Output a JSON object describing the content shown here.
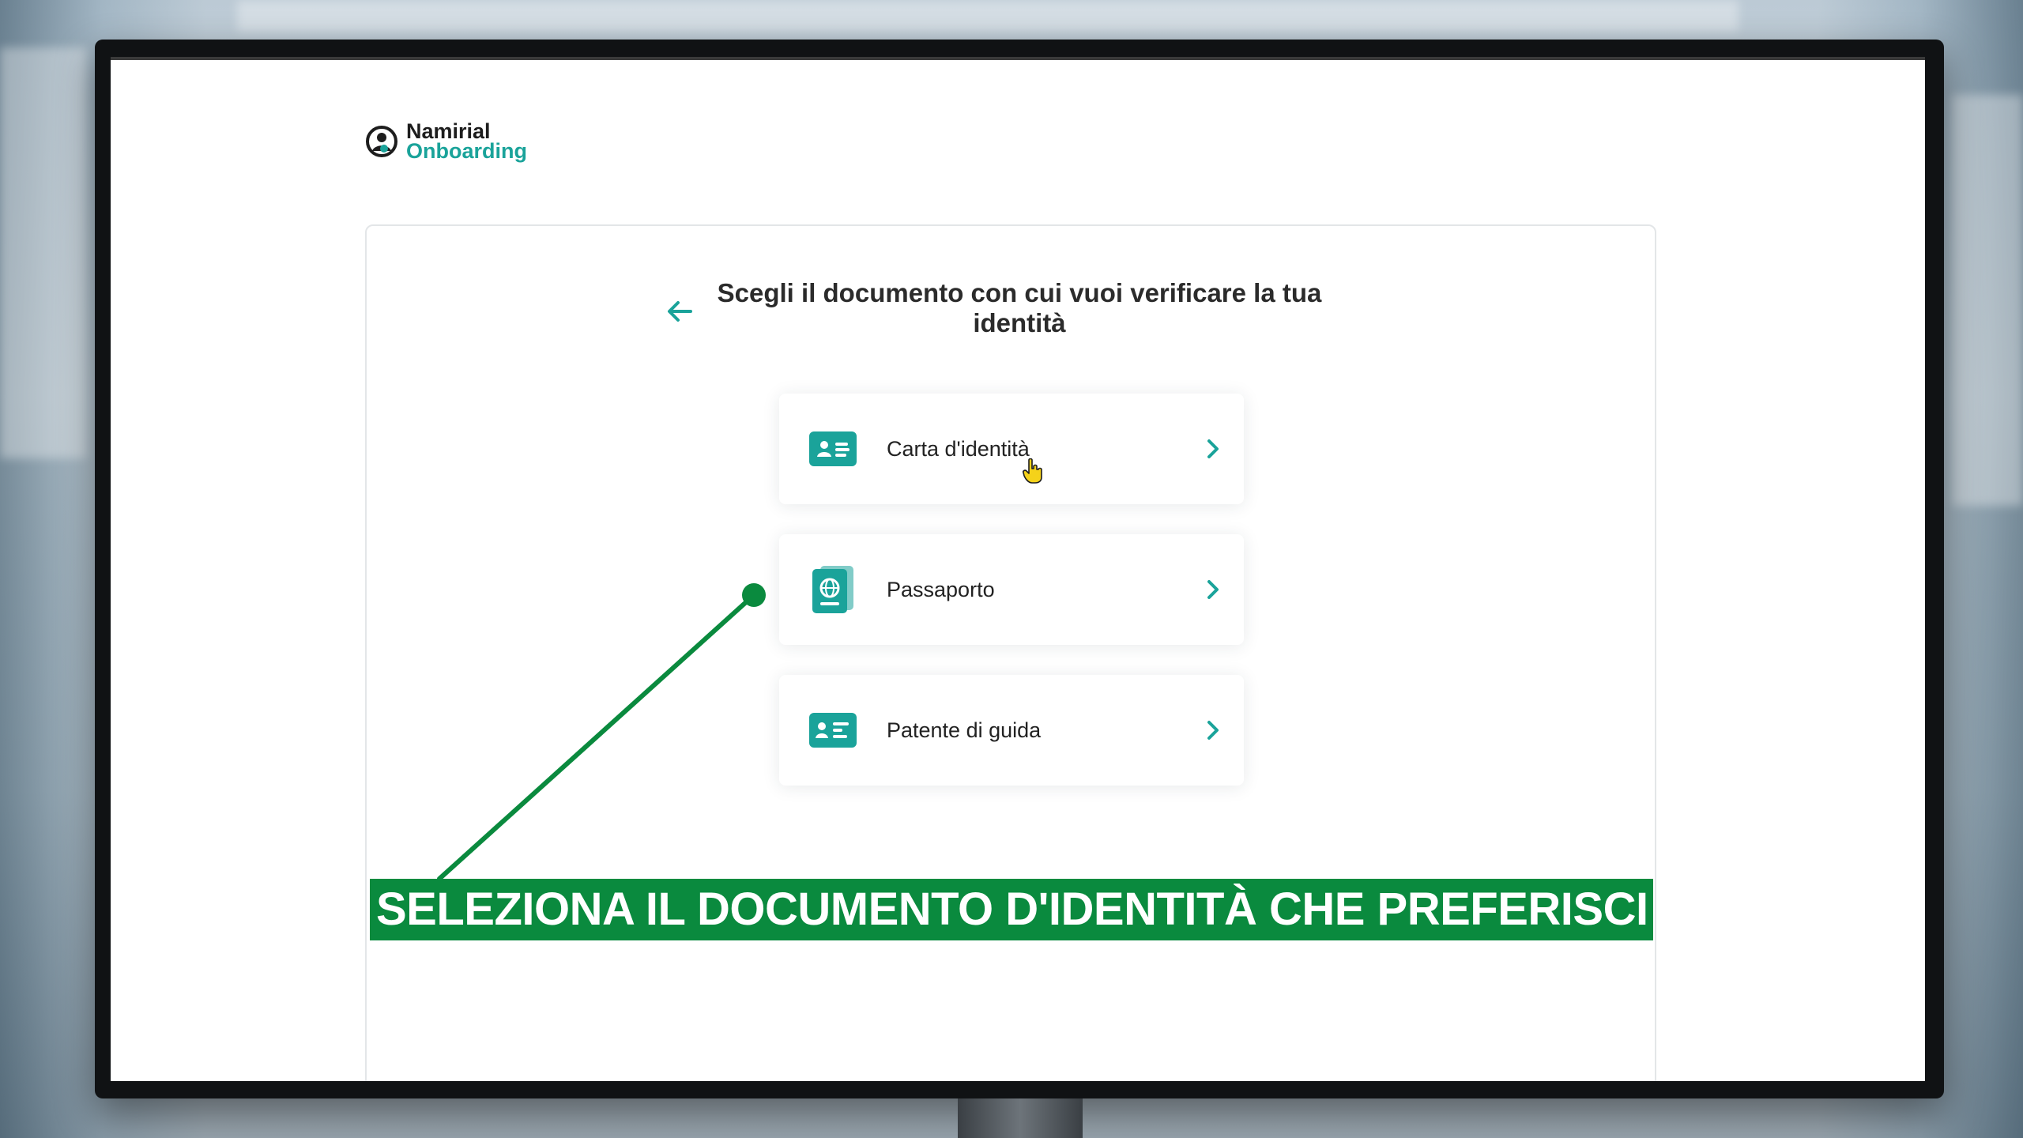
{
  "brand": {
    "line1": "Namirial",
    "line2": "Onboarding",
    "accent_color": "#1aa39a"
  },
  "page": {
    "title": "Scegli il documento con cui vuoi verificare la tua identità",
    "back_icon": "arrow-left-icon"
  },
  "documents": [
    {
      "label": "Carta d'identità",
      "icon": "id-card-icon"
    },
    {
      "label": "Passaporto",
      "icon": "passport-icon"
    },
    {
      "label": "Patente di guida",
      "icon": "driving-license-icon"
    }
  ],
  "overlay": {
    "banner_text": "SELEZIONA IL DOCUMENTO D'IDENTITÀ CHE PREFERISCI",
    "banner_color": "#0a8a3e"
  }
}
